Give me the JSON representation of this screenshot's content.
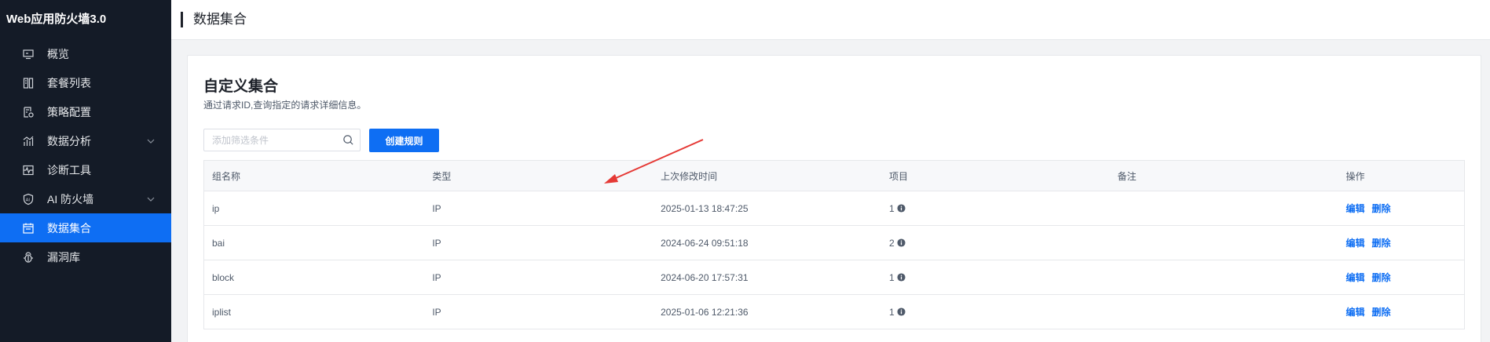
{
  "app": {
    "title": "Web应用防火墙3.0"
  },
  "sidebar": {
    "items": [
      {
        "label": "概览",
        "icon": "monitor-icon",
        "active": false,
        "expandable": false
      },
      {
        "label": "套餐列表",
        "icon": "package-list-icon",
        "active": false,
        "expandable": false
      },
      {
        "label": "策略配置",
        "icon": "policy-icon",
        "active": false,
        "expandable": false
      },
      {
        "label": "数据分析",
        "icon": "analytics-icon",
        "active": false,
        "expandable": true
      },
      {
        "label": "诊断工具",
        "icon": "diagnose-icon",
        "active": false,
        "expandable": false
      },
      {
        "label": "AI 防火墙",
        "icon": "ai-shield-icon",
        "active": false,
        "expandable": true
      },
      {
        "label": "数据集合",
        "icon": "data-collection-icon",
        "active": true,
        "expandable": false
      },
      {
        "label": "漏洞库",
        "icon": "vulnerability-icon",
        "active": false,
        "expandable": false
      }
    ]
  },
  "header": {
    "title": "数据集合"
  },
  "main": {
    "title": "自定义集合",
    "description": "通过请求ID,查询指定的请求详细信息。",
    "search": {
      "placeholder": "添加筛选条件",
      "value": ""
    },
    "create_button": "创建规则",
    "table": {
      "columns": [
        "组名称",
        "类型",
        "上次修改时间",
        "项目",
        "备注",
        "操作"
      ],
      "rows": [
        {
          "name": "ip",
          "type": "IP",
          "modified": "2025-01-13 18:47:25",
          "items": "1",
          "remark": "",
          "edit": "编辑",
          "delete": "删除"
        },
        {
          "name": "bai",
          "type": "IP",
          "modified": "2024-06-24 09:51:18",
          "items": "2",
          "remark": "",
          "edit": "编辑",
          "delete": "删除"
        },
        {
          "name": "block",
          "type": "IP",
          "modified": "2024-06-20 17:57:31",
          "items": "1",
          "remark": "",
          "edit": "编辑",
          "delete": "删除"
        },
        {
          "name": "iplist",
          "type": "IP",
          "modified": "2025-01-06 12:21:36",
          "items": "1",
          "remark": "",
          "edit": "编辑",
          "delete": "删除"
        }
      ]
    }
  },
  "colors": {
    "sidebar_bg": "#141b27",
    "accent": "#0e6ef3",
    "annotation_arrow": "#e53935"
  }
}
